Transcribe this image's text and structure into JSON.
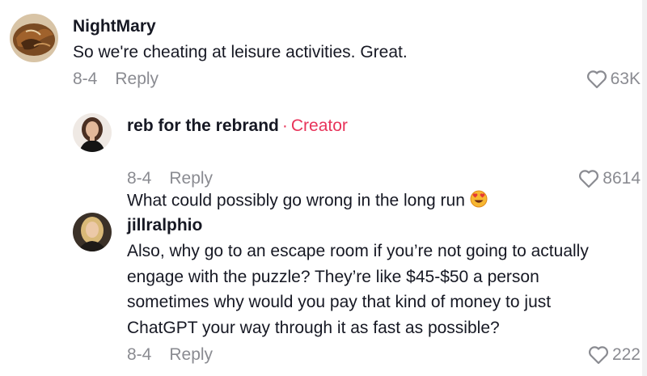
{
  "comments": [
    {
      "username": "NightMary",
      "text": "So we're cheating at leisure activities. Great.",
      "date": "8-4",
      "reply_label": "Reply",
      "likes": "63K",
      "avatar": "food-photo-avatar"
    },
    {
      "username": "reb for the rebrand",
      "creator_label": "Creator",
      "text": "What could possibly go wrong in the long run",
      "emoji": "heart-eyes-emoji",
      "date": "8-4",
      "reply_label": "Reply",
      "likes": "8614",
      "avatar": "woman-portrait-avatar"
    },
    {
      "username": "jillralphio",
      "text": "Also, why go to an escape room if you’re not going to actually\nengage with the puzzle? They’re like $45-$50 a person\nsometimes why would you pay that kind of money to just\nChatGPT your way through it as fast as possible?",
      "date": "8-4",
      "reply_label": "Reply",
      "likes": "222",
      "avatar": "blonde-woman-avatar"
    }
  ],
  "colors": {
    "text": "#161823",
    "muted": "#8a8b91",
    "creator": "#e8345a"
  }
}
